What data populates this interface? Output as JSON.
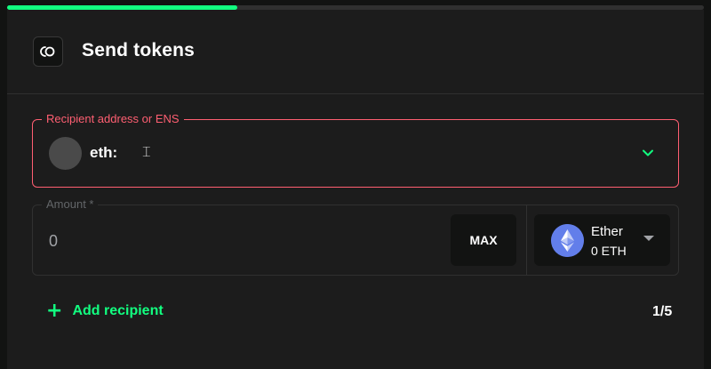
{
  "progress": {
    "fraction": 0.33,
    "color": "#12ff80"
  },
  "header": {
    "title": "Send tokens",
    "logo_icon": "safe-logo-icon"
  },
  "recipient": {
    "legend": "Recipient address or ENS",
    "value": "eth:",
    "avatar_icon": "identicon-avatar",
    "chevron_icon": "chevron-down-icon",
    "error_color": "#ff5f72"
  },
  "amount": {
    "legend": "Amount *",
    "value": "",
    "placeholder": "0",
    "max_label": "MAX"
  },
  "token": {
    "name": "Ether",
    "balance": "0 ETH",
    "icon": "ethereum-icon",
    "caret_icon": "caret-down-icon"
  },
  "footer": {
    "add_recipient_label": "Add recipient",
    "plus_icon": "plus-icon",
    "recipient_count": "1/5"
  },
  "colors": {
    "accent": "#12ff80",
    "background": "#121312",
    "card": "#1c1c1c",
    "border": "#303030"
  }
}
